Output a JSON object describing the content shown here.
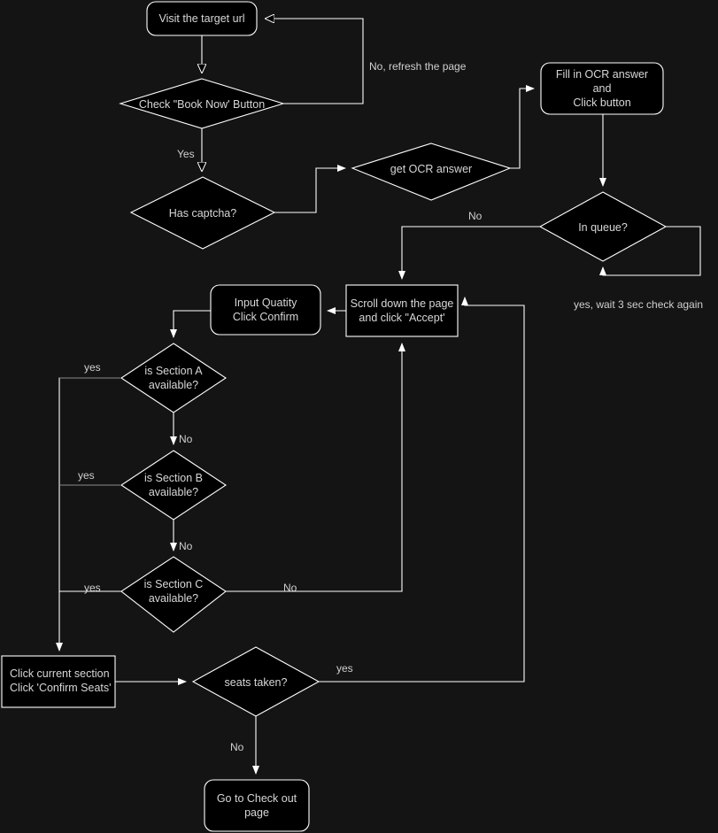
{
  "diagram": {
    "title": "Ticket booking automation flowchart",
    "background_color": "#141414",
    "node_fill_color": "#000000",
    "stroke_color": "#ffffff",
    "text_color": "#d7d7d7",
    "dim_stroke_color": "#8a8a8a"
  },
  "nodes": [
    {
      "id": "visit",
      "label": "Visit the target url",
      "shape": "rounded-rect"
    },
    {
      "id": "check_book",
      "label": "Check \"Book Now' Button",
      "shape": "diamond"
    },
    {
      "id": "has_captcha",
      "label": "Has captcha?",
      "shape": "diamond"
    },
    {
      "id": "get_ocr",
      "label": "get OCR answer",
      "shape": "diamond"
    },
    {
      "id": "fill_ocr",
      "label": "Fill in OCR answer\nand\nClick button",
      "shape": "rounded-rect"
    },
    {
      "id": "in_queue",
      "label": "In queue?",
      "shape": "diamond"
    },
    {
      "id": "scroll",
      "label": "Scroll down the page\nand click \"Accept'",
      "shape": "rect"
    },
    {
      "id": "input_qty",
      "label": "Input Quatity\nClick Confirm",
      "shape": "rounded-rect"
    },
    {
      "id": "section_a",
      "label": "is Section A\navailable?",
      "shape": "diamond"
    },
    {
      "id": "section_b",
      "label": "is Section B\navailable?",
      "shape": "diamond"
    },
    {
      "id": "section_c",
      "label": "is Section C\navailable?",
      "shape": "diamond"
    },
    {
      "id": "click_sec",
      "label": "Click current section\nClick 'Confirm Seats'",
      "shape": "rect"
    },
    {
      "id": "seats_taken",
      "label": "seats taken?",
      "shape": "diamond"
    },
    {
      "id": "checkout",
      "label": "Go to Check out\npage",
      "shape": "rounded-rect"
    }
  ],
  "edge_labels": [
    {
      "id": "e_refresh",
      "text": "No, refresh the page"
    },
    {
      "id": "e_yes_book",
      "text": "Yes"
    },
    {
      "id": "e_no_queue",
      "text": "No"
    },
    {
      "id": "e_wait",
      "text": "yes, wait 3 sec check again"
    },
    {
      "id": "e_yes_a",
      "text": "yes"
    },
    {
      "id": "e_no_a",
      "text": "No"
    },
    {
      "id": "e_yes_b",
      "text": "yes"
    },
    {
      "id": "e_no_b",
      "text": "No"
    },
    {
      "id": "e_yes_c",
      "text": "yes"
    },
    {
      "id": "e_no_c",
      "text": "No"
    },
    {
      "id": "e_yes_seats",
      "text": "yes"
    },
    {
      "id": "e_no_seats",
      "text": "No"
    }
  ]
}
